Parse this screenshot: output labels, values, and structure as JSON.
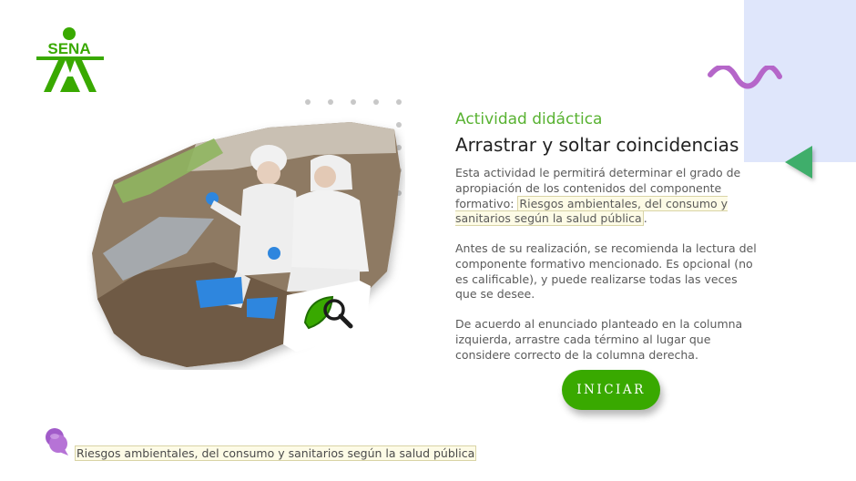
{
  "brand": {
    "logo_text": "SENA",
    "primary_color": "#39a900",
    "accent_color": "#58b231",
    "panel_color": "#dfe6fb",
    "wave_color": "#b566c9",
    "triangle_color": "#3fae6b"
  },
  "header": {
    "eyebrow": "Actividad didáctica",
    "title": "Arrastrar y soltar coincidencias"
  },
  "content": {
    "p1_text": "Esta actividad le permitirá determinar el grado de apropiación de los contenidos del componente formativo: ",
    "p1_highlight": "Riesgos ambientales, del consumo y sanitarios según la salud pública",
    "p1_end": ".",
    "p2": "Antes de su realización, se recomienda la lectura del componente formativo mencionado.  Es opcional (no es calificable), y puede realizarse todas las veces que se desee.",
    "p3": "De acuerdo al enunciado planteado en la columna izquierda, arrastre cada término al lugar que considere correcto de la columna derecha."
  },
  "actions": {
    "start_label": "INICIAR"
  },
  "footer": {
    "reference": "Riesgos ambientales, del consumo y sanitarios según la salud pública"
  },
  "icons": {
    "badge": "leaf-magnifier-icon",
    "footer": "speech-bubble-icon"
  }
}
